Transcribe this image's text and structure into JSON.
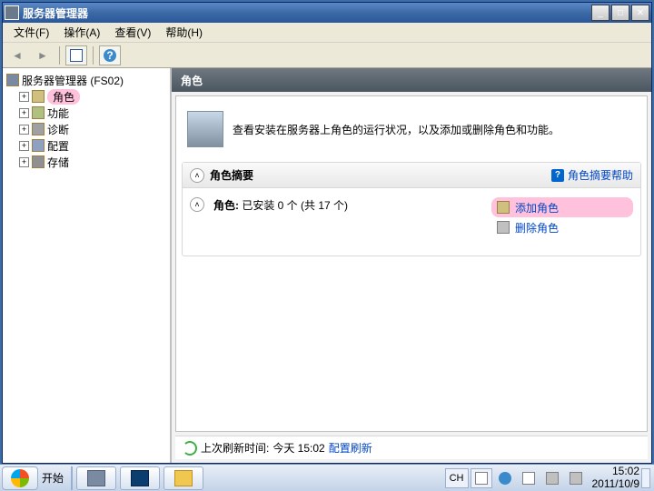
{
  "window": {
    "title": "服务器管理器",
    "min_btn": "_",
    "max_btn": "□",
    "close_btn": "✕"
  },
  "menubar": {
    "file": "文件(F)",
    "action": "操作(A)",
    "view": "查看(V)",
    "help": "帮助(H)"
  },
  "tree": {
    "root": "服务器管理器 (FS02)",
    "roles": "角色",
    "features": "功能",
    "diagnostics": "诊断",
    "config": "配置",
    "storage": "存储"
  },
  "content": {
    "header": "角色",
    "description": "查看安装在服务器上角色的运行状况，以及添加或删除角色和功能。",
    "summary_title": "角色摘要",
    "help_link": "角色摘要帮助",
    "roles_status_label": "角色:",
    "roles_status_value": "已安装 0 个 (共 17 个)",
    "add_role": "添加角色",
    "remove_role": "删除角色",
    "last_refresh_label": "上次刷新时间:",
    "last_refresh_value": "今天 15:02",
    "config_refresh": "配置刷新"
  },
  "taskbar": {
    "start": "开始",
    "ime": "CH",
    "time": "15:02",
    "date": "2011/10/9"
  },
  "icons": {
    "collapse": "˄",
    "help_q": "?",
    "plus": "+"
  }
}
